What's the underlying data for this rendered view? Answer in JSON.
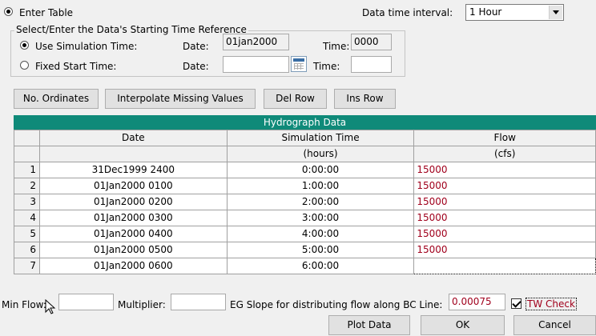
{
  "top": {
    "enter_table_label": "Enter Table",
    "interval_label": "Data time interval:",
    "interval_value": "1 Hour"
  },
  "reference": {
    "group_title": "Select/Enter the Data's Starting Time Reference",
    "sim_time_label": "Use Simulation Time:",
    "sim_date_label": "Date:",
    "sim_date_value": "01jan2000",
    "sim_time_label2": "Time:",
    "sim_time_value": "0000",
    "fixed_label": "Fixed Start Time:",
    "fixed_date_label": "Date:",
    "fixed_date_value": "",
    "fixed_time_label": "Time:",
    "fixed_time_value": ""
  },
  "toolbar": {
    "ordinates": "No. Ordinates",
    "interpolate": "Interpolate Missing Values",
    "del_row": "Del Row",
    "ins_row": "Ins Row"
  },
  "grid": {
    "title": "Hydrograph Data",
    "columns": [
      {
        "name": "Date",
        "unit": ""
      },
      {
        "name": "Simulation Time",
        "unit": "(hours)"
      },
      {
        "name": "Flow",
        "unit": "(cfs)"
      }
    ],
    "rows": [
      {
        "n": "1",
        "date": "31Dec1999 2400",
        "time": "0:00:00",
        "flow": "15000"
      },
      {
        "n": "2",
        "date": "01Jan2000 0100",
        "time": "1:00:00",
        "flow": "15000"
      },
      {
        "n": "3",
        "date": "01Jan2000 0200",
        "time": "2:00:00",
        "flow": "15000"
      },
      {
        "n": "4",
        "date": "01Jan2000 0300",
        "time": "3:00:00",
        "flow": "15000"
      },
      {
        "n": "5",
        "date": "01Jan2000 0400",
        "time": "4:00:00",
        "flow": "15000"
      },
      {
        "n": "6",
        "date": "01Jan2000 0500",
        "time": "5:00:00",
        "flow": "15000"
      },
      {
        "n": "7",
        "date": "01Jan2000 0600",
        "time": "6:00:00",
        "flow": ""
      }
    ]
  },
  "bottom": {
    "min_flow_label": "Min Flow:",
    "min_flow_value": "",
    "multiplier_label": "Multiplier:",
    "multiplier_value": "",
    "eg_slope_label": "EG Slope for distributing flow along BC Line:",
    "eg_slope_value": "0.00075",
    "tw_check_label": "TW Check",
    "plot": "Plot Data",
    "ok": "OK",
    "cancel": "Cancel"
  }
}
